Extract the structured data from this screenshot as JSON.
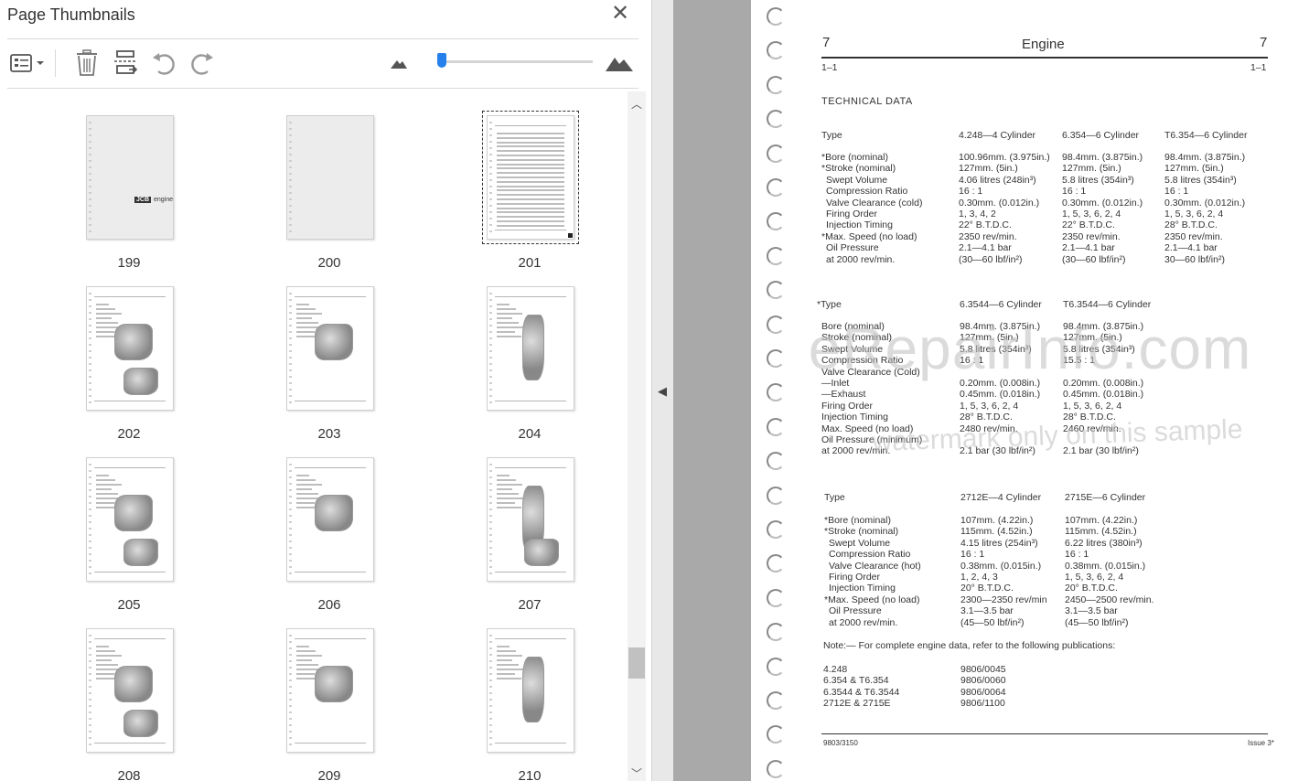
{
  "panel": {
    "title": "Page Thumbnails",
    "close_icon": "close-icon",
    "toolbar": {
      "options_icon": "thumbnail-options-icon",
      "delete_icon": "trash-icon",
      "extract_icon": "extract-pages-icon",
      "rotate_ccw_icon": "rotate-counterclockwise-icon",
      "rotate_cw_icon": "rotate-clockwise-icon",
      "zoom_out_icon": "small-mountain-icon",
      "zoom_in_icon": "large-mountain-icon",
      "zoom_level_fraction": 0.03
    },
    "thumbnails": [
      "199",
      "200",
      "201",
      "202",
      "203",
      "204",
      "205",
      "206",
      "207",
      "208",
      "209",
      "210"
    ],
    "selected_page": "201",
    "cover_logo_text": "JCB",
    "cover_logo_sub": "engine"
  },
  "document": {
    "header": {
      "section": "7",
      "title": "Engine",
      "section_right": "7",
      "sub_left": "1–1",
      "sub_right": "1–1"
    },
    "heading": "TECHNICAL DATA",
    "table1": {
      "cols": [
        "Type",
        "4.248—4 Cylinder",
        "6.354—6 Cylinder",
        "T6.354—6 Cylinder"
      ],
      "rows": [
        [
          "*Bore (nominal)",
          "100.96mm. (3.975in.)",
          "98.4mm. (3.875in.)",
          "98.4mm. (3.875in.)"
        ],
        [
          "*Stroke (nominal)",
          "127mm. (5in.)",
          "127mm. (5in.)",
          "127mm. (5in.)"
        ],
        [
          "Swept Volume",
          "4.06 litres (248in³)",
          "5.8 litres (354in³)",
          "5.8 litres (354in³)"
        ],
        [
          "Compression Ratio",
          "16 : 1",
          "16 : 1",
          "16 : 1"
        ],
        [
          "Valve Clearance (cold)",
          "0.30mm. (0.012in.)",
          "0.30mm. (0.012in.)",
          "0.30mm. (0.012in.)"
        ],
        [
          "Firing Order",
          "1, 3, 4, 2",
          "1, 5, 3, 6, 2, 4",
          "1, 5, 3, 6, 2, 4"
        ],
        [
          "Injection Timing",
          "22° B.T.D.C.",
          "22° B.T.D.C.",
          "28° B.T.D.C."
        ],
        [
          "*Max. Speed (no load)",
          "2350 rev/min.",
          "2350 rev/min.",
          "2350 rev/min."
        ],
        [
          "Oil Pressure",
          "2.1—4.1 bar",
          "2.1—4.1 bar",
          "2.1—4.1 bar"
        ],
        [
          "at 2000 rev/min.",
          "(30—60 lbf/in²)",
          "(30—60 lbf/in²)",
          "30—60 lbf/in²)"
        ]
      ]
    },
    "table2": {
      "cols": [
        "*Type",
        "6.3544—6 Cylinder",
        "T6.3544—6 Cylinder"
      ],
      "rows": [
        [
          "Bore (nominal)",
          "98.4mm. (3.875in.)",
          "98.4mm. (3.875in.)"
        ],
        [
          "Stroke (nominal)",
          "127mm. (5in.)",
          "127mm. (5in.)"
        ],
        [
          "Swept Volume",
          "5.8 litres (354in³)",
          "5.8 litres (354in³)"
        ],
        [
          "Compression Ratio",
          "16 : 1",
          "15.5 : 1"
        ],
        [
          "Valve Clearance (Cold)",
          "",
          ""
        ],
        [
          "—Inlet",
          "0.20mm. (0.008in.)",
          "0.20mm. (0.008in.)"
        ],
        [
          "—Exhaust",
          "0.45mm. (0.018in.)",
          "0.45mm. (0.018in.)"
        ],
        [
          "Firing Order",
          "1, 5, 3, 6, 2, 4",
          "1, 5, 3, 6, 2, 4"
        ],
        [
          "Injection Timing",
          "28° B.T.D.C.",
          "28° B.T.D.C."
        ],
        [
          "Max. Speed (no load)",
          "2480 rev/min.",
          "2460 rev/min."
        ],
        [
          "Oil Pressure (minimum)",
          "",
          ""
        ],
        [
          "at 2000 rev/min.",
          "2.1 bar (30 lbf/in²)",
          "2.1 bar (30 lbf/in²)"
        ]
      ]
    },
    "table3": {
      "cols": [
        "Type",
        "2712E—4 Cylinder",
        "2715E—6 Cylinder"
      ],
      "rows": [
        [
          "*Bore (nominal)",
          "107mm. (4.22in.)",
          "107mm. (4.22in.)"
        ],
        [
          "*Stroke (nominal)",
          "115mm. (4.52in.)",
          "115mm. (4.52in.)"
        ],
        [
          "Swept Volume",
          "4.15 litres (254in³)",
          "6.22 litres (380in³)"
        ],
        [
          "Compression Ratio",
          "16 : 1",
          "16 : 1"
        ],
        [
          "Valve Clearance (hot)",
          "0.38mm. (0.015in.)",
          "0.38mm. (0.015in.)"
        ],
        [
          "Firing Order",
          "1, 2, 4, 3",
          "1, 5, 3, 6, 2, 4"
        ],
        [
          "Injection Timing",
          "20° B.T.D.C.",
          "20° B.T.D.C."
        ],
        [
          "*Max. Speed (no load)",
          "2300—2350 rev/min",
          "2450—2500 rev/min."
        ],
        [
          "Oil Pressure",
          "3.1—3.5 bar",
          "3.1—3.5 bar"
        ],
        [
          "at 2000 rev/min.",
          "(45—50 lbf/in²)",
          "(45—50 lbf/in²)"
        ]
      ]
    },
    "note": "Note:—   For complete engine data, refer to the following publications:",
    "publications": [
      [
        "4.248",
        "9806/0045"
      ],
      [
        "6.354 & T6.354",
        "9806/0060"
      ],
      [
        "6.3544 & T6.3544",
        "9806/0064"
      ],
      [
        "2712E & 2715E",
        "9806/1100"
      ]
    ],
    "footer_left": "9803/3150",
    "footer_right": "Issue 3*",
    "watermark_main": "eRepairInfo.com",
    "watermark_sub": "watermark only on this sample"
  }
}
